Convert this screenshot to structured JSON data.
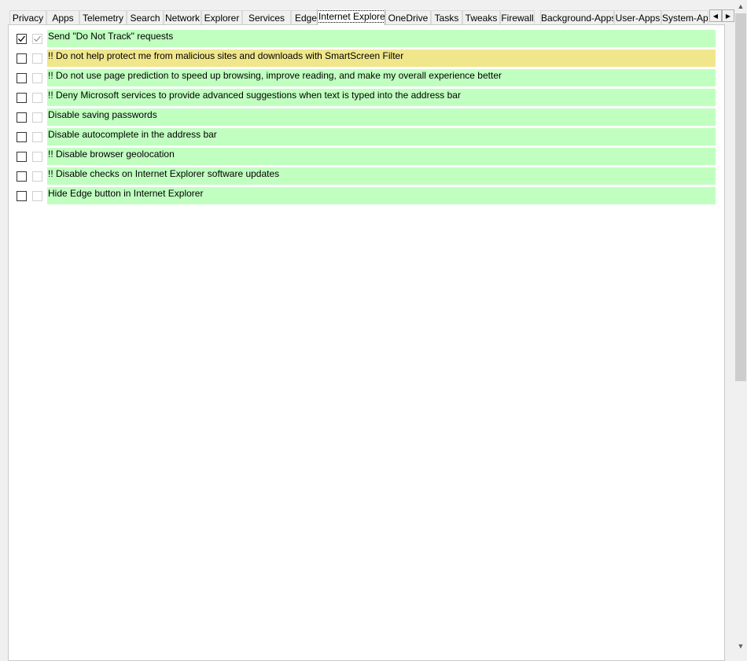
{
  "tabs": [
    {
      "label": "Privacy",
      "active": false
    },
    {
      "label": "Apps",
      "active": false
    },
    {
      "label": "Telemetry",
      "active": false
    },
    {
      "label": "Search",
      "active": false
    },
    {
      "label": "Network",
      "active": false
    },
    {
      "label": "Explorer",
      "active": false
    },
    {
      "label": "Services",
      "active": false
    },
    {
      "label": "Edge",
      "active": false
    },
    {
      "label": "Internet Explorer",
      "active": true
    },
    {
      "label": "OneDrive",
      "active": false
    },
    {
      "label": "Tasks",
      "active": false
    },
    {
      "label": "Tweaks",
      "active": false
    },
    {
      "label": "Firewall",
      "active": false
    },
    {
      "label": "Background-Apps",
      "active": false
    },
    {
      "label": "User-Apps",
      "active": false
    },
    {
      "label": "System-Apps",
      "active": false
    }
  ],
  "tab_scroll": {
    "left_glyph": "◀",
    "right_glyph": "▶"
  },
  "colors": {
    "recommended": "#c0ffc0",
    "caution": "#f0e68c"
  },
  "settings": [
    {
      "label": "Send \"Do Not Track\" requests",
      "checked": true,
      "default": true,
      "level": "recommended"
    },
    {
      "label": "!! Do not help protect me from malicious sites and downloads with SmartScreen Filter",
      "checked": false,
      "default": false,
      "level": "caution"
    },
    {
      "label": "!! Do not use page prediction to speed up browsing, improve reading, and make my overall experience better",
      "checked": false,
      "default": false,
      "level": "recommended"
    },
    {
      "label": "!! Deny Microsoft services to provide advanced suggestions when text is typed into the address bar",
      "checked": false,
      "default": false,
      "level": "recommended"
    },
    {
      "label": "Disable saving passwords",
      "checked": false,
      "default": false,
      "level": "recommended"
    },
    {
      "label": "Disable autocomplete in the address bar",
      "checked": false,
      "default": false,
      "level": "recommended"
    },
    {
      "label": "!! Disable browser geolocation",
      "checked": false,
      "default": false,
      "level": "recommended"
    },
    {
      "label": "!! Disable checks on Internet Explorer software updates",
      "checked": false,
      "default": false,
      "level": "recommended"
    },
    {
      "label": "Hide Edge button in Internet Explorer",
      "checked": false,
      "default": false,
      "level": "recommended"
    }
  ],
  "scrollbar": {
    "up_glyph": "▲",
    "down_glyph": "▼"
  }
}
